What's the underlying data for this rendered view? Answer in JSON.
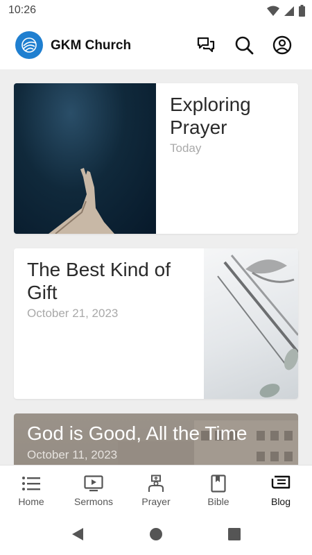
{
  "status": {
    "time": "10:26"
  },
  "app": {
    "title": "GKM Church"
  },
  "posts": [
    {
      "title": "Exploring Prayer",
      "date": "Today"
    },
    {
      "title": "The Best Kind of Gift",
      "date": "October 21, 2023"
    },
    {
      "title": "God is Good, All the Time",
      "date": "October 11, 2023"
    }
  ],
  "nav": {
    "items": [
      {
        "label": "Home",
        "icon": "list-icon"
      },
      {
        "label": "Sermons",
        "icon": "video-icon"
      },
      {
        "label": "Prayer",
        "icon": "prayer-icon"
      },
      {
        "label": "Bible",
        "icon": "bible-icon"
      },
      {
        "label": "Blog",
        "icon": "blog-icon"
      }
    ],
    "active": "Blog"
  },
  "colors": {
    "brand": "#1f7fd0",
    "feed_bg": "#eeeeee",
    "date_text": "#a9a9a9"
  }
}
